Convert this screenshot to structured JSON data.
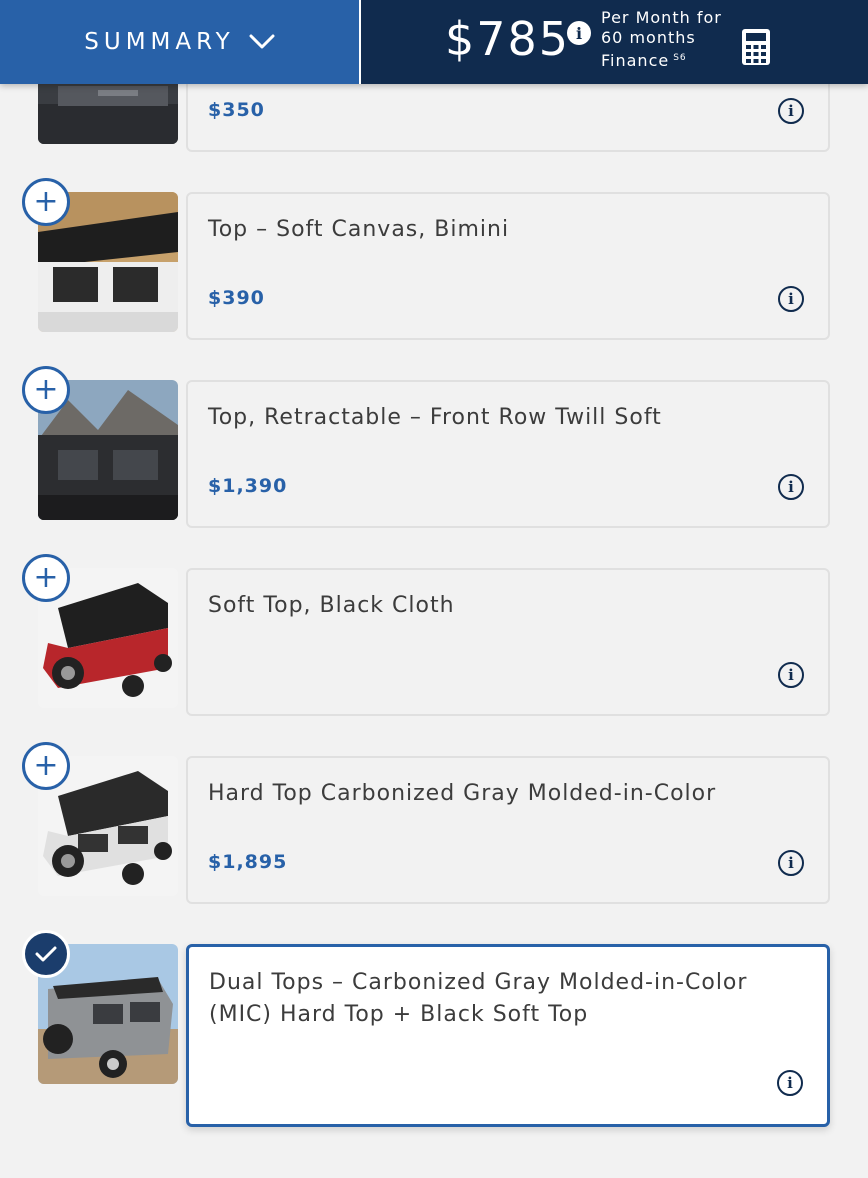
{
  "header": {
    "summary_label": "SUMMARY",
    "price": "$785",
    "terms_line1": "Per Month for",
    "terms_line2": "60 months",
    "terms_line3": "Finance",
    "disclosure": "S6",
    "info_glyph": "i",
    "summary_color": "#2861a8",
    "price_bar_color": "#102b4e"
  },
  "options": [
    {
      "title": "",
      "price": "$350",
      "state": "add",
      "image": "vehicle-top-partial"
    },
    {
      "title": "Top – Soft Canvas, Bimini",
      "price": "$390",
      "state": "add",
      "image": "white-bronco-bimini"
    },
    {
      "title": "Top, Retractable – Front Row Twill Soft",
      "price": "$1,390",
      "state": "add",
      "image": "dark-bronco-mountains"
    },
    {
      "title": "Soft Top, Black Cloth",
      "price": "",
      "state": "add",
      "image": "red-bronco-soft-top"
    },
    {
      "title": "Hard Top Carbonized Gray Molded-in-Color",
      "price": "$1,895",
      "state": "add",
      "image": "white-bronco-hard-top"
    },
    {
      "title": "Dual Tops – Carbonized Gray Molded-in-Color (MIC) Hard Top + Black Soft Top",
      "price": "",
      "state": "selected",
      "image": "gray-bronco-beach"
    }
  ],
  "icons": {
    "add": "plus-icon",
    "selected": "check-icon",
    "info": "info-icon",
    "calculator": "calculator-icon",
    "summary_toggle": "chevron-down-icon"
  }
}
